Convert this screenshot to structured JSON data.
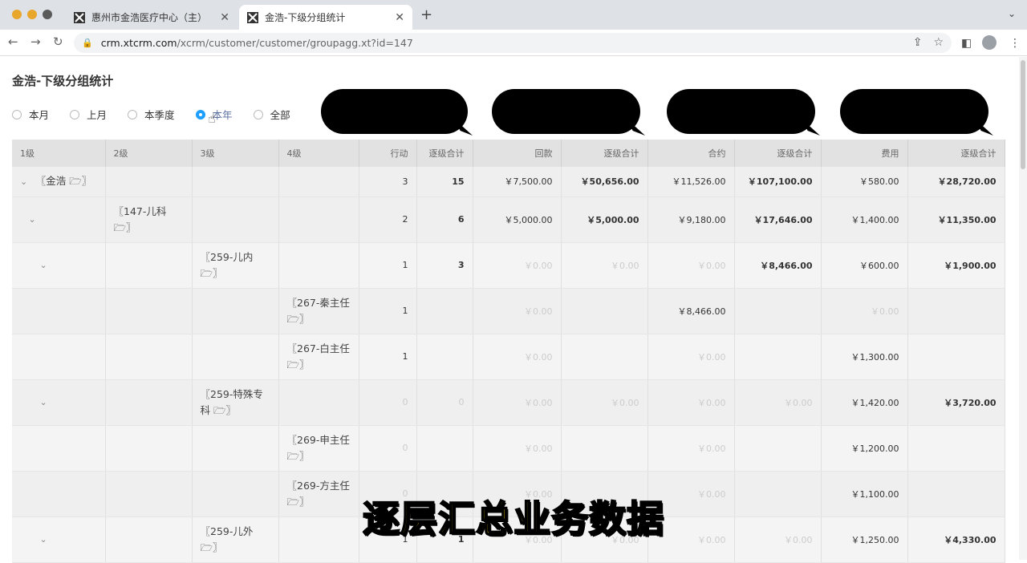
{
  "browser": {
    "tabs": [
      {
        "title": "惠州市金浩医疗中心（主）",
        "close": "✕"
      },
      {
        "title": "金浩-下级分组统计",
        "close": "✕"
      }
    ],
    "new_tab": "+",
    "url_host": "crm.xtcrm.com",
    "url_path": "/xcrm/customer/customer/groupagg.xt?id=147"
  },
  "page": {
    "title": "金浩-下级分组统计",
    "period_options": [
      {
        "label": "本月",
        "checked": false
      },
      {
        "label": "上月",
        "checked": false
      },
      {
        "label": "本季度",
        "checked": false
      },
      {
        "label": "本年",
        "checked": true
      },
      {
        "label": "全部",
        "checked": false
      }
    ]
  },
  "table": {
    "headers": [
      "1级",
      "2级",
      "3级",
      "4级",
      "行动",
      "逐级合计",
      "回款",
      "逐级合计",
      "合约",
      "逐级合计",
      "费用",
      "逐级合计"
    ],
    "rows": [
      {
        "l1": "〖金浩 🗁〗",
        "l2": "",
        "l3": "",
        "l4": "",
        "action": "3",
        "action_sum": "15",
        "payment": "￥7,500.00",
        "payment_sum": "￥50,656.00",
        "contract": "￥11,526.00",
        "contract_sum": "￥107,100.00",
        "fee": "￥580.00",
        "fee_sum": "￥28,720.00"
      },
      {
        "l1": "",
        "l2": "〖147-儿科 🗁〗",
        "l3": "",
        "l4": "",
        "action": "2",
        "action_sum": "6",
        "payment": "￥5,000.00",
        "payment_sum": "￥5,000.00",
        "contract": "￥9,180.00",
        "contract_sum": "￥17,646.00",
        "fee": "￥1,400.00",
        "fee_sum": "￥11,350.00"
      },
      {
        "l1": "",
        "l2": "",
        "l3": "〖259-儿内 🗁〗",
        "l4": "",
        "action": "1",
        "action_sum": "3",
        "payment": "￥0.00",
        "payment_sum": "￥0.00",
        "contract": "￥0.00",
        "contract_sum": "￥8,466.00",
        "fee": "￥600.00",
        "fee_sum": "￥1,900.00"
      },
      {
        "l1": "",
        "l2": "",
        "l3": "",
        "l4": "〖267-秦主任 🗁〗",
        "action": "1",
        "action_sum": "",
        "payment": "￥0.00",
        "payment_sum": "",
        "contract": "￥8,466.00",
        "contract_sum": "",
        "fee": "￥0.00",
        "fee_sum": ""
      },
      {
        "l1": "",
        "l2": "",
        "l3": "",
        "l4": "〖267-白主任 🗁〗",
        "action": "1",
        "action_sum": "",
        "payment": "￥0.00",
        "payment_sum": "",
        "contract": "￥0.00",
        "contract_sum": "",
        "fee": "￥1,300.00",
        "fee_sum": ""
      },
      {
        "l1": "",
        "l2": "",
        "l3": "〖259-特殊专科 🗁〗",
        "l4": "",
        "action": "0",
        "action_sum": "0",
        "payment": "￥0.00",
        "payment_sum": "￥0.00",
        "contract": "￥0.00",
        "contract_sum": "￥0.00",
        "fee": "￥1,420.00",
        "fee_sum": "￥3,720.00"
      },
      {
        "l1": "",
        "l2": "",
        "l3": "",
        "l4": "〖269-申主任 🗁〗",
        "action": "0",
        "action_sum": "",
        "payment": "￥0.00",
        "payment_sum": "",
        "contract": "￥0.00",
        "contract_sum": "",
        "fee": "￥1,200.00",
        "fee_sum": ""
      },
      {
        "l1": "",
        "l2": "",
        "l3": "",
        "l4": "〖269-方主任 🗁〗",
        "action": "0",
        "action_sum": "",
        "payment": "￥0.00",
        "payment_sum": "",
        "contract": "￥0.00",
        "contract_sum": "",
        "fee": "￥1,100.00",
        "fee_sum": ""
      },
      {
        "l1": "",
        "l2": "",
        "l3": "〖259-儿外 🗁〗",
        "l4": "",
        "action": "1",
        "action_sum": "1",
        "payment": "￥0.00",
        "payment_sum": "￥0.00",
        "contract": "￥0.00",
        "contract_sum": "￥0.00",
        "fee": "￥1,250.00",
        "fee_sum": "￥4,330.00"
      }
    ]
  },
  "overlay_caption": "逐层汇总业务数据"
}
